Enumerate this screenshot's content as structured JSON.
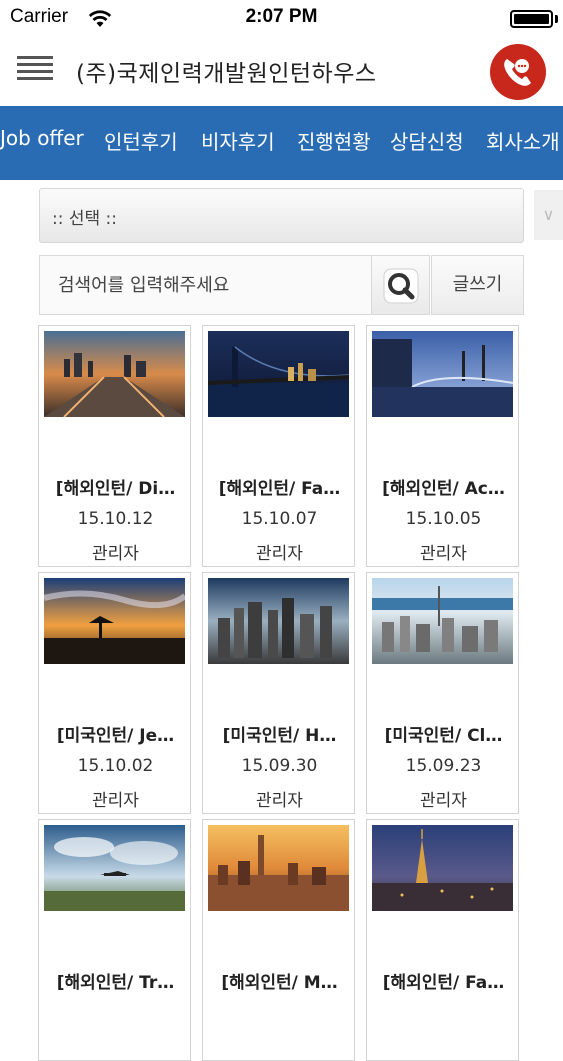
{
  "status_bar": {
    "carrier": "Carrier",
    "time": "2:07 PM"
  },
  "header": {
    "title": "(주)국제인력개발원인턴하우스"
  },
  "nav": [
    {
      "label": "Job offer"
    },
    {
      "label": "인턴후기"
    },
    {
      "label": "비자후기"
    },
    {
      "label": "진행현황"
    },
    {
      "label": "상담신청"
    },
    {
      "label": "회사소개"
    }
  ],
  "filter": {
    "selected": ":: 선택 ::"
  },
  "search": {
    "placeholder": "검색어를 입력해주세요",
    "write_label": "글쓰기"
  },
  "posts": [
    {
      "title": "[해외인턴/ Di…",
      "date": "15.10.12",
      "author": "관리자"
    },
    {
      "title": "[해외인턴/ Fa…",
      "date": "15.10.07",
      "author": "관리자"
    },
    {
      "title": "[해외인턴/ Ac…",
      "date": "15.10.05",
      "author": "관리자"
    },
    {
      "title": "[미국인턴/ Je…",
      "date": "15.10.02",
      "author": "관리자"
    },
    {
      "title": "[미국인턴/ H…",
      "date": "15.09.30",
      "author": "관리자"
    },
    {
      "title": "[미국인턴/ Cl…",
      "date": "15.09.23",
      "author": "관리자"
    },
    {
      "title": "[해외인턴/ Tr…",
      "date": "",
      "author": ""
    },
    {
      "title": "[해외인턴/ M…",
      "date": "",
      "author": ""
    },
    {
      "title": "[해외인턴/ Fa…",
      "date": "",
      "author": ""
    }
  ],
  "colors": {
    "nav_bg": "#2a6cb4",
    "call_button": "#c8281c"
  }
}
